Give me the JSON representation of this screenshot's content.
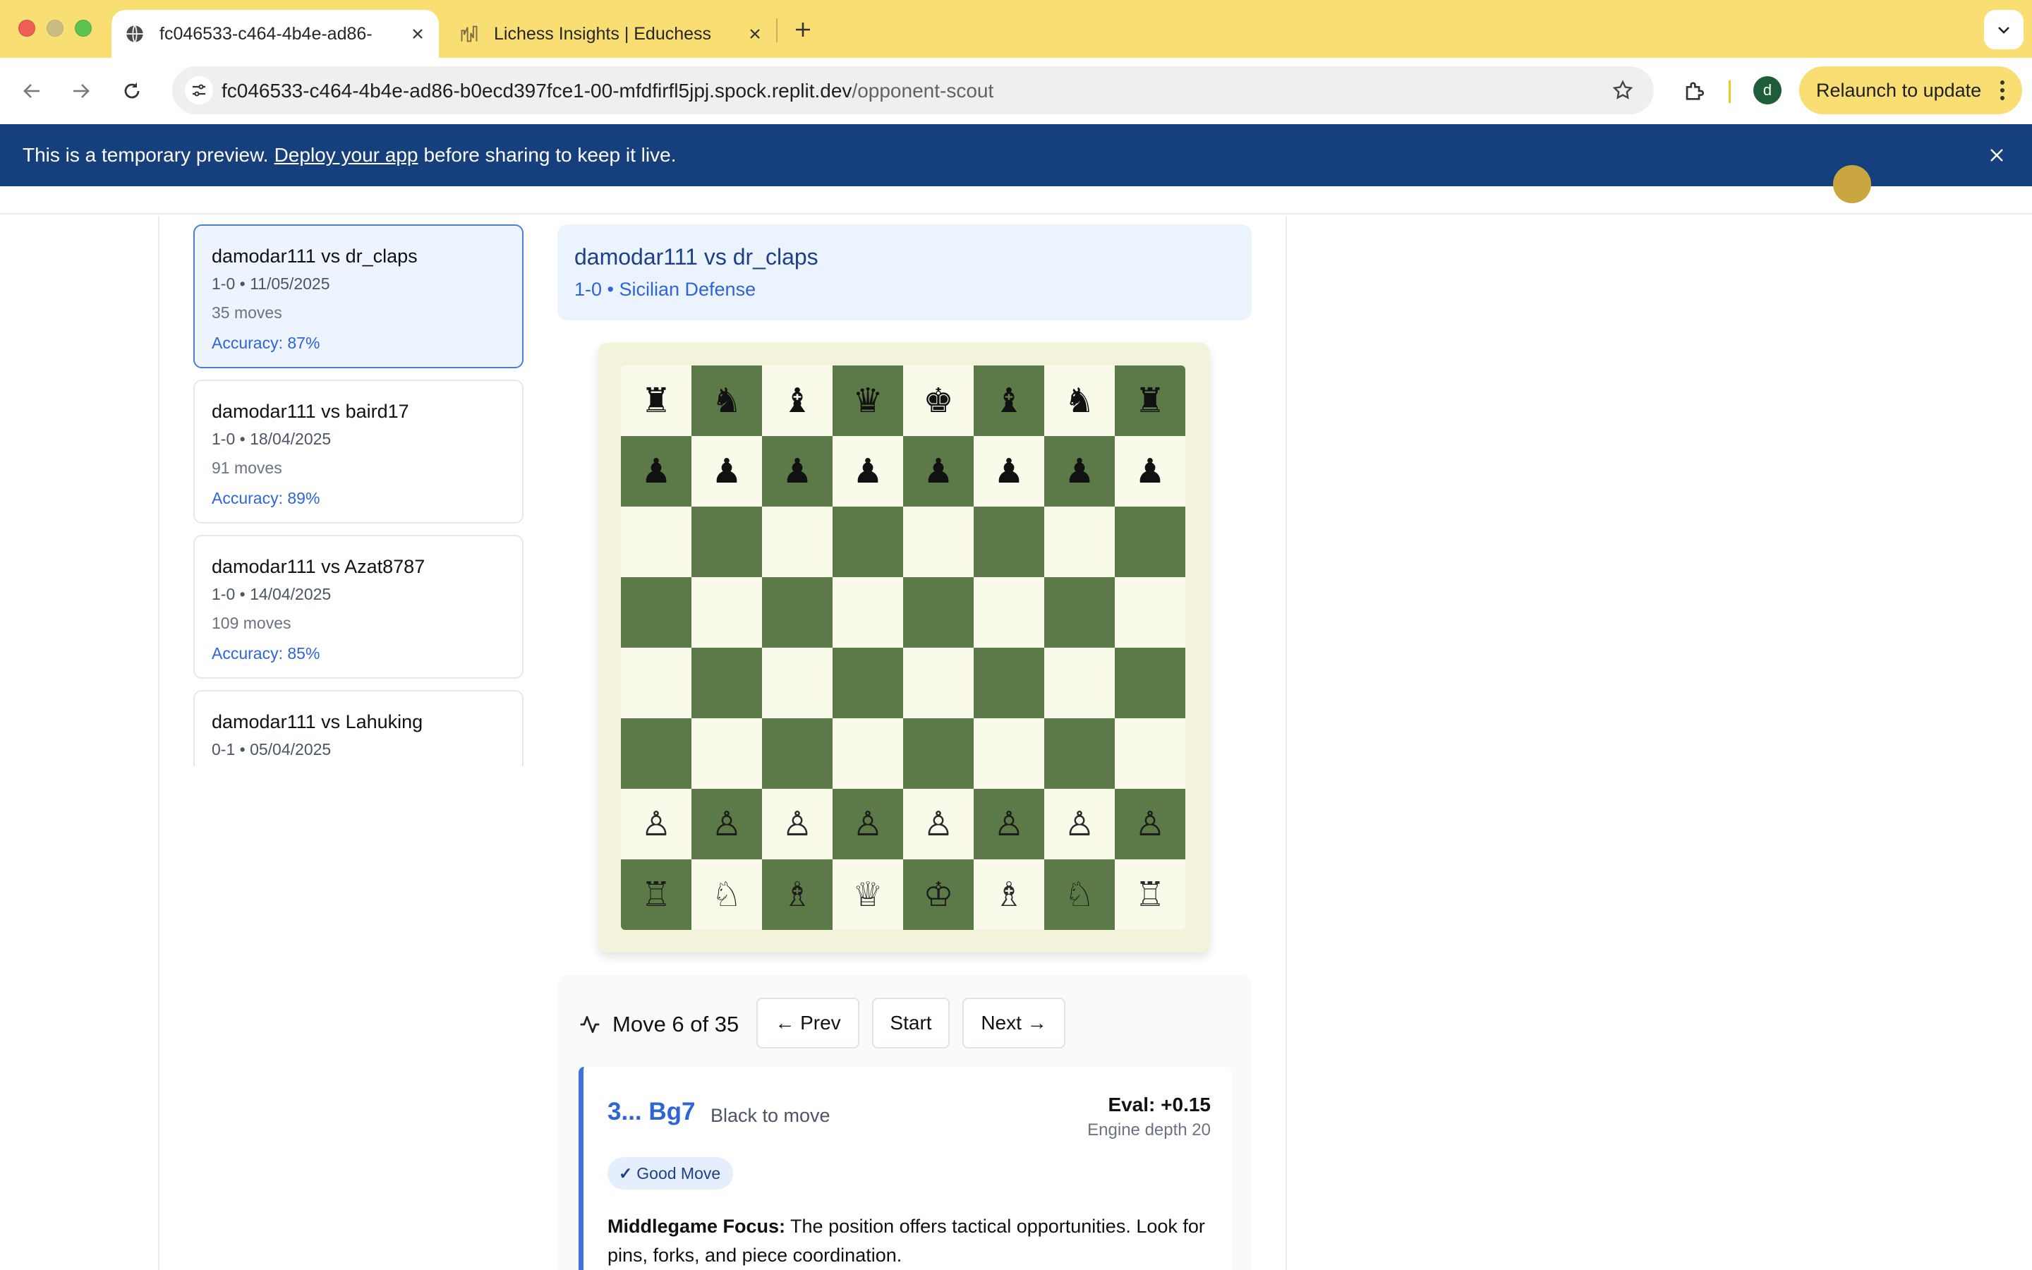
{
  "browser": {
    "tabs": [
      {
        "title": "fc046533-c464-4b4e-ad86-",
        "active": true
      },
      {
        "title": "Lichess Insights | Educhess",
        "active": false
      }
    ],
    "url_host": "fc046533-c464-4b4e-ad86-b0ecd397fce1-00-mfdfirfl5jpj.spock.replit.dev",
    "url_path": "/opponent-scout",
    "profile_initial": "d",
    "relaunch_label": "Relaunch to update"
  },
  "banner": {
    "text_before": "This is a temporary preview.",
    "link": "Deploy your app",
    "text_after": "before sharing to keep it live."
  },
  "games": [
    {
      "title": "damodar111 vs dr_claps",
      "meta": "1-0 • 11/05/2025",
      "moves": "35 moves",
      "accuracy": "Accuracy: 87%"
    },
    {
      "title": "damodar111 vs baird17",
      "meta": "1-0 • 18/04/2025",
      "moves": "91 moves",
      "accuracy": "Accuracy: 89%"
    },
    {
      "title": "damodar111 vs Azat8787",
      "meta": "1-0 • 14/04/2025",
      "moves": "109 moves",
      "accuracy": "Accuracy: 85%"
    },
    {
      "title": "damodar111 vs Lahuking",
      "meta": "0-1 • 05/04/2025",
      "moves": "",
      "accuracy": ""
    }
  ],
  "selected_game": {
    "title": "damodar111 vs dr_claps",
    "subtitle": "1-0 • Sicilian Defense"
  },
  "board": {
    "ranks": [
      [
        "♜",
        "♞",
        "♝",
        "♛",
        "♚",
        "♝",
        "♞",
        "♜"
      ],
      [
        "♟",
        "♟",
        "♟",
        "♟",
        "♟",
        "♟",
        "♟",
        "♟"
      ],
      [
        "",
        "",
        "",
        "",
        "",
        "",
        "",
        ""
      ],
      [
        "",
        "",
        "",
        "",
        "",
        "",
        "",
        ""
      ],
      [
        "",
        "",
        "",
        "",
        "",
        "",
        "",
        ""
      ],
      [
        "",
        "",
        "",
        "",
        "",
        "",
        "",
        ""
      ],
      [
        "♙",
        "♙",
        "♙",
        "♙",
        "♙",
        "♙",
        "♙",
        "♙"
      ],
      [
        "♖",
        "♘",
        "♗",
        "♕",
        "♔",
        "♗",
        "♘",
        "♖"
      ]
    ],
    "light_color": "#fafaea",
    "dark_color": "#5b7a48"
  },
  "analysis": {
    "move_counter": "Move 6 of 35",
    "prev_label": "← Prev",
    "start_label": "Start",
    "next_label": "Next →",
    "move_san": "3... Bg7",
    "side_to_move": "Black to move",
    "eval": "Eval: +0.15",
    "depth": "Engine depth 20",
    "badge": "Good Move",
    "note_title": "Middlegame Focus:",
    "note_text": " The position offers tactical opportunities. Look for pins, forks, and piece coordination."
  },
  "colors": {
    "tabstrip": "#f9df73",
    "banner": "#163f7e",
    "accent_blue": "#2f64d8"
  }
}
